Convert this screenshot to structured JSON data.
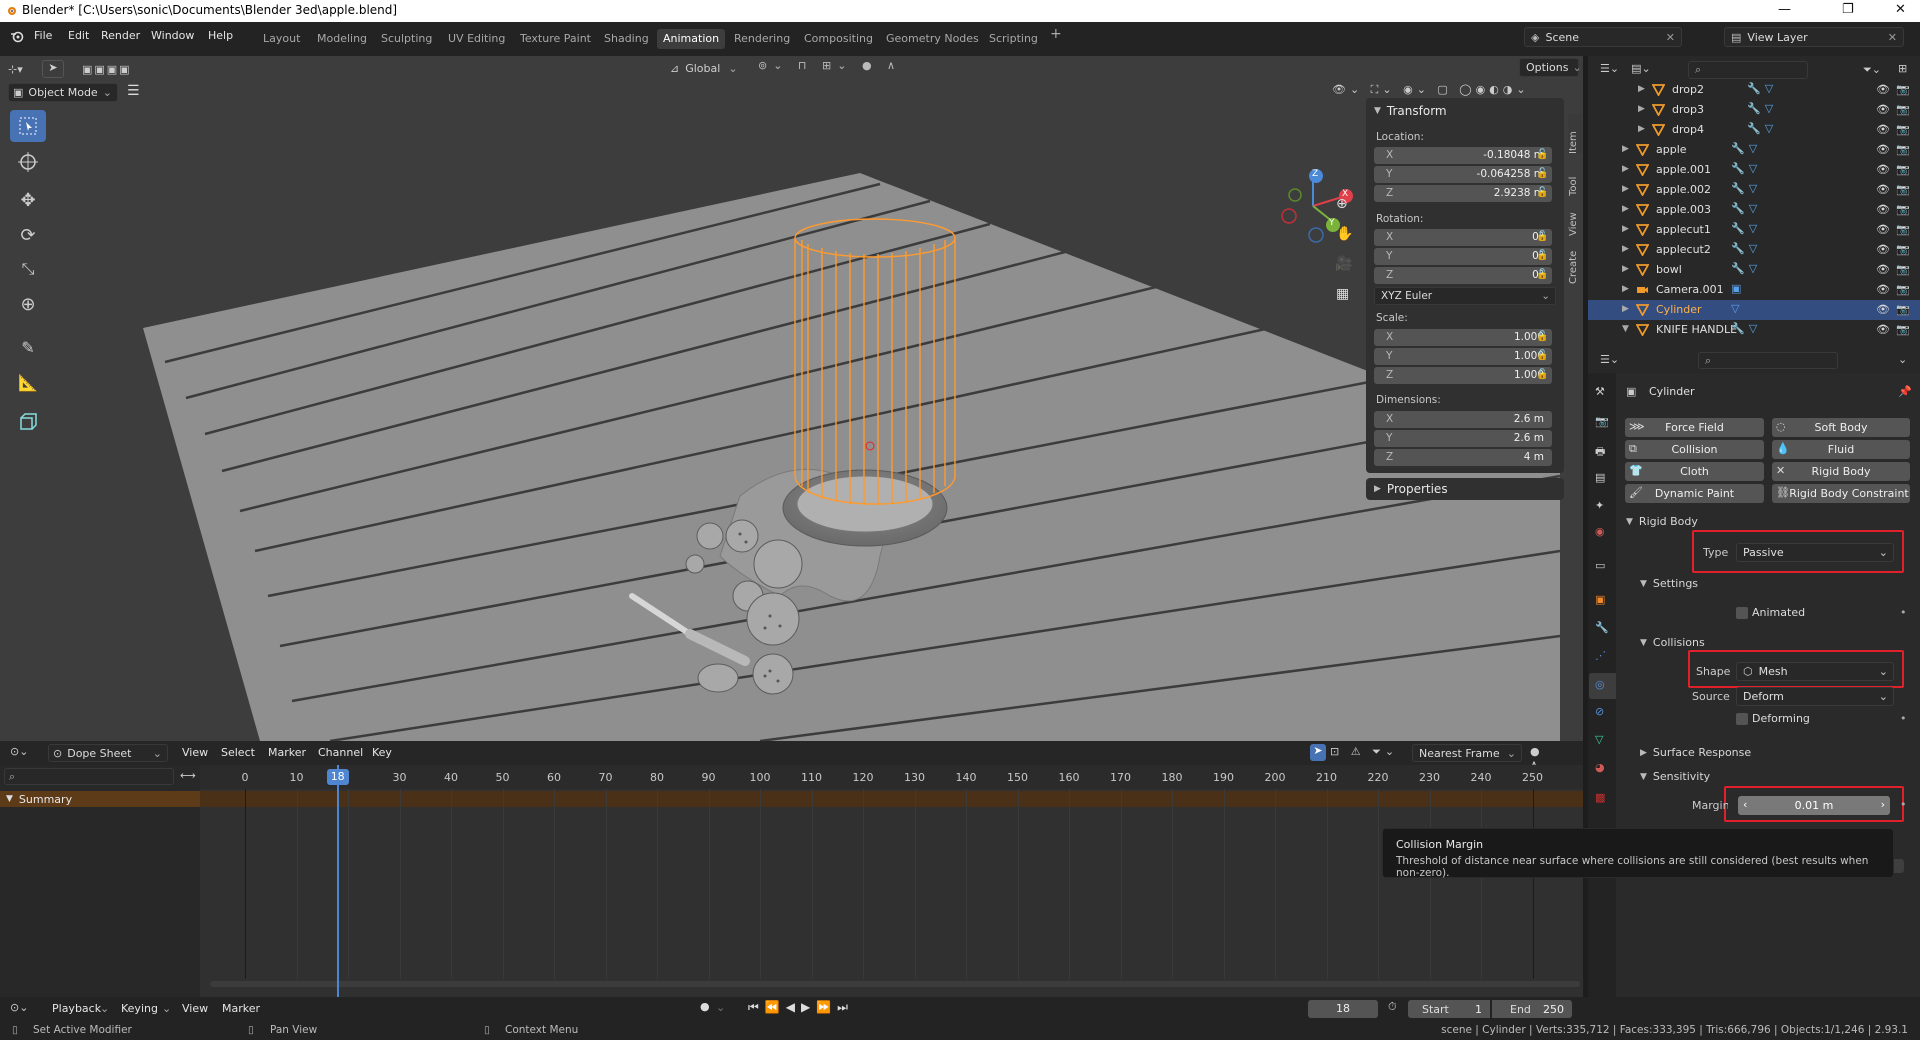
{
  "window": {
    "title": "Blender* [C:\\Users\\sonic\\Documents\\Blender 3ed\\apple.blend]"
  },
  "menus": [
    "File",
    "Edit",
    "Render",
    "Window",
    "Help"
  ],
  "workspaces": [
    "Layout",
    "Modeling",
    "Sculpting",
    "UV Editing",
    "Texture Paint",
    "Shading",
    "Animation",
    "Rendering",
    "Compositing",
    "Geometry Nodes",
    "Scripting"
  ],
  "active_workspace": "Animation",
  "scene": {
    "name": "Scene",
    "view_layer": "View Layer"
  },
  "viewport": {
    "orientation": "Global",
    "options_label": "Options",
    "mode": "Object Mode",
    "gizmo_axes": [
      "X",
      "Y",
      "Z"
    ]
  },
  "npanel": {
    "transform_title": "Transform",
    "location_label": "Location:",
    "location": {
      "x": "-0.18048 m",
      "y": "-0.064258 m",
      "z": "2.9238 m"
    },
    "rotation_label": "Rotation:",
    "rotation": {
      "x": "0°",
      "y": "0°",
      "z": "0°"
    },
    "rotation_mode": "XYZ Euler",
    "scale_label": "Scale:",
    "scale": {
      "x": "1.000",
      "y": "1.000",
      "z": "1.000"
    },
    "dimensions_label": "Dimensions:",
    "dimensions": {
      "x": "2.6 m",
      "y": "2.6 m",
      "z": "4 m"
    },
    "properties_title": "Properties",
    "axis_x": "X",
    "axis_y": "Y",
    "axis_z": "Z",
    "tabs": [
      "Item",
      "Tool",
      "View",
      "Create"
    ]
  },
  "outliner": {
    "items": [
      {
        "name": "drop2",
        "indent": 2,
        "selected": false
      },
      {
        "name": "drop3",
        "indent": 2,
        "selected": false
      },
      {
        "name": "drop4",
        "indent": 2,
        "selected": false
      },
      {
        "name": "apple",
        "indent": 1,
        "selected": false
      },
      {
        "name": "apple.001",
        "indent": 1,
        "selected": false
      },
      {
        "name": "apple.002",
        "indent": 1,
        "selected": false
      },
      {
        "name": "apple.003",
        "indent": 1,
        "selected": false
      },
      {
        "name": "applecut1",
        "indent": 1,
        "selected": false
      },
      {
        "name": "applecut2",
        "indent": 1,
        "selected": false
      },
      {
        "name": "bowl",
        "indent": 1,
        "selected": false
      },
      {
        "name": "Camera.001",
        "indent": 1,
        "selected": false
      },
      {
        "name": "Cylinder",
        "indent": 1,
        "selected": true
      },
      {
        "name": "KNIFE HANDLE",
        "indent": 1,
        "selected": false
      }
    ]
  },
  "properties": {
    "object_name": "Cylinder",
    "physics_buttons": [
      [
        "Force Field",
        "Soft Body"
      ],
      [
        "Collision",
        "Fluid"
      ],
      [
        "Cloth",
        "Rigid Body"
      ],
      [
        "Dynamic Paint",
        "Rigid Body Constraint"
      ]
    ],
    "rigid_body_title": "Rigid Body",
    "type_label": "Type",
    "type_value": "Passive",
    "settings_title": "Settings",
    "animated_label": "Animated",
    "collisions_title": "Collisions",
    "shape_label": "Shape",
    "shape_value": "Mesh",
    "source_label": "Source",
    "source_value": "Deform",
    "deforming_label": "Deforming",
    "surface_response_title": "Surface Response",
    "sensitivity_title": "Sensitivity",
    "margin_label": "Margin",
    "margin_value": "0.01 m"
  },
  "tooltip": {
    "title": "Collision Margin",
    "body": "Threshold of distance near surface where collisions are still considered (best results when non-zero)."
  },
  "dopesheet": {
    "editor": "Dope Sheet",
    "menus": [
      "View",
      "Select",
      "Marker",
      "Channel",
      "Key"
    ],
    "snap": "Nearest Frame",
    "summary_label": "Summary",
    "frame_ticks": [
      "0",
      "10",
      "30",
      "40",
      "50",
      "60",
      "70",
      "80",
      "90",
      "100",
      "110",
      "120",
      "130",
      "140",
      "150",
      "160",
      "170",
      "180",
      "190",
      "200",
      "210",
      "220",
      "230",
      "240",
      "250"
    ],
    "current_frame": "18"
  },
  "playback": {
    "menus": [
      "Playback",
      "Keying",
      "View",
      "Marker"
    ],
    "current_frame": "18",
    "start_label": "Start",
    "start_value": "1",
    "end_label": "End",
    "end_value": "250"
  },
  "statusbar": {
    "left1": "Set Active Modifier",
    "left2": "Pan View",
    "left3": "Context Menu",
    "stats": "scene | Cylinder | Verts:335,712 | Faces:333,395 | Tris:666,796 | Objects:1/1,246 | 2.93.1"
  },
  "colors": {
    "accent": "#4772b3",
    "highlight_red": "#e0202a",
    "selection_orange": "#ff9a2e",
    "workspace_active": "#3d3d3d"
  }
}
